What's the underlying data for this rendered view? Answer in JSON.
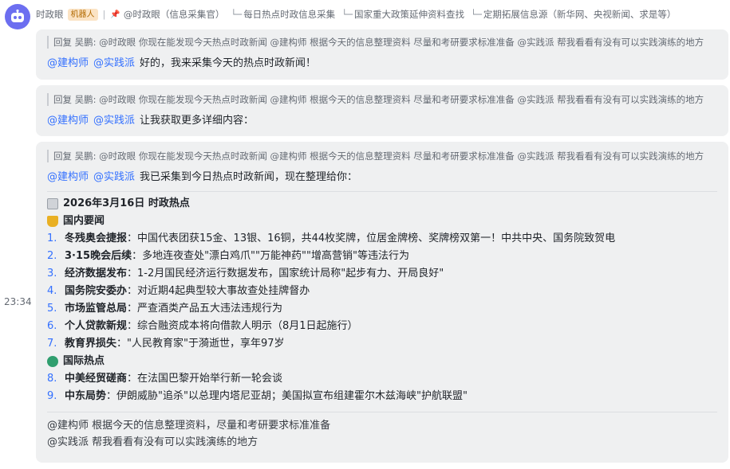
{
  "sender": {
    "name": "时政眼",
    "badge": "机器人",
    "mention": "@时政眼（信息采集官）",
    "tasks": [
      "每日热点时政信息采集",
      "国家重大政策延伸资料查找",
      "定期拓展信息源（新华网、央视新闻、求是等）"
    ]
  },
  "timestamp": "23:34",
  "colors": {
    "accent": "#3370ff",
    "bubble": "#eff0f1",
    "avatar": "#6c6ef0"
  },
  "messages": [
    {
      "reply": "回复 吴鹏: @时政眼 你现在能发现今天热点时政新闻 @建构师 根据今天的信息整理资料 尽量和考研要求标准准备 @实践派 帮我看看有没有可以实践演练的地方",
      "mentions": [
        "@建构师",
        "@实践派"
      ],
      "text": "好的，我来采集今天的热点时政新闻！"
    },
    {
      "reply": "回复 吴鹏: @时政眼 你现在能发现今天热点时政新闻 @建构师 根据今天的信息整理资料 尽量和考研要求标准准备 @实践派 帮我看看有没有可以实践演练的地方",
      "mentions": [
        "@建构师",
        "@实践派"
      ],
      "text": "让我获取更多详细内容："
    },
    {
      "reply": "回复 吴鹏: @时政眼 你现在能发现今天热点时政新闻 @建构师 根据今天的信息整理资料 尽量和考研要求标准准备 @实践派 帮我看看有没有可以实践演练的地方",
      "mentions": [
        "@建构师",
        "@实践派"
      ],
      "text": "我已采集到今日热点时政新闻，现在整理给你：",
      "report_title": "2026年3月16日 时政热点",
      "domestic_title": "国内要闻",
      "domestic": [
        {
          "n": "1.",
          "b": "冬残奥会捷报",
          "t": "：中国代表团获15金、13银、16铜，共44枚奖牌，位居金牌榜、奖牌榜双第一！中共中央、国务院致贺电"
        },
        {
          "n": "2.",
          "b": "3·15晚会后续",
          "t": "：多地连夜查处\"漂白鸡爪\"\"万能神药\"\"增高营销\"等违法行为"
        },
        {
          "n": "3.",
          "b": "经济数据发布",
          "t": "：1-2月国民经济运行数据发布，国家统计局称\"起步有力、开局良好\""
        },
        {
          "n": "4.",
          "b": "国务院安委办",
          "t": "：对近期4起典型较大事故查处挂牌督办"
        },
        {
          "n": "5.",
          "b": "市场监管总局",
          "t": "：严查酒类产品五大违法违规行为"
        },
        {
          "n": "6.",
          "b": "个人贷款新规",
          "t": "：综合融资成本将向借款人明示（8月1日起施行）"
        },
        {
          "n": "7.",
          "b": "教育界损失",
          "t": "：\"人民教育家\"于漪逝世，享年97岁"
        }
      ],
      "intl_title": "国际热点",
      "intl": [
        {
          "n": "8.",
          "b": "中美经贸磋商",
          "t": "：在法国巴黎开始举行新一轮会谈"
        },
        {
          "n": "9.",
          "b": "中东局势",
          "t": "：伊朗威胁\"追杀\"以总理内塔尼亚胡；美国拟宣布组建霍尔木兹海峡\"护航联盟\""
        }
      ],
      "footer": [
        "@建构师 根据今天的信息整理资料，尽量和考研要求标准准备",
        "@实践派 帮我看看有没有可以实践演练的地方"
      ]
    }
  ]
}
